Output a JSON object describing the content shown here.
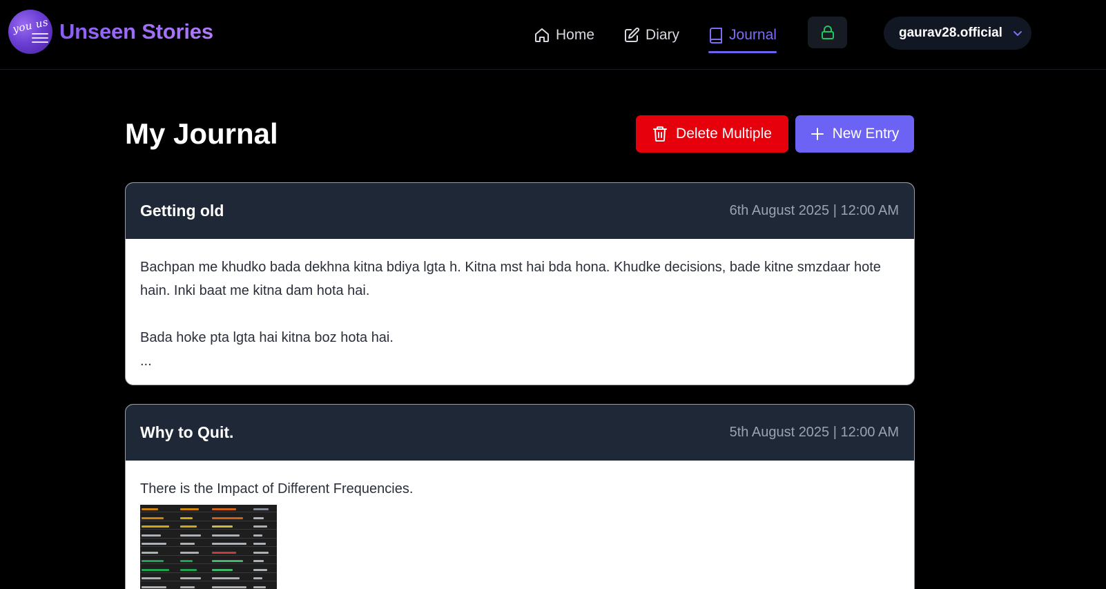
{
  "brand": {
    "logo_text": "you us",
    "name": "Unseen Stories"
  },
  "nav": {
    "home": "Home",
    "diary": "Diary",
    "journal": "Journal",
    "active": "Journal"
  },
  "user": {
    "name": "gaurav28.official"
  },
  "page": {
    "title": "My Journal",
    "delete_multiple_label": "Delete Multiple",
    "new_entry_label": "New Entry"
  },
  "entries": [
    {
      "title": "Getting old",
      "date": "6th August 2025 | 12:00 AM",
      "paragraphs": [
        "Bachpan me khudko bada dekhna kitna bdiya lgta h. Kitna mst hai bda hona. Khudke decisions, bade kitne smzdaar hote hain. Inki baat me kitna dam hota hai.",
        "Bada hoke pta lgta hai kitna boz hota hai.",
        "..."
      ]
    },
    {
      "title": "Why to Quit.",
      "date": "5th August 2025 | 12:00 AM",
      "paragraphs": [
        "There is the Impact of Different Frequencies."
      ],
      "has_image": true
    }
  ],
  "colors": {
    "accent": "#6c63f4",
    "danger": "#e5000c",
    "card_header": "#1f2837",
    "lock_icon": "#22c55e"
  },
  "icons": {
    "home": "home-icon",
    "diary": "edit-icon",
    "journal": "book-icon",
    "lock": "lock-icon",
    "user_menu": "chevron-down-icon",
    "delete": "trash-icon",
    "new": "plus-icon"
  }
}
